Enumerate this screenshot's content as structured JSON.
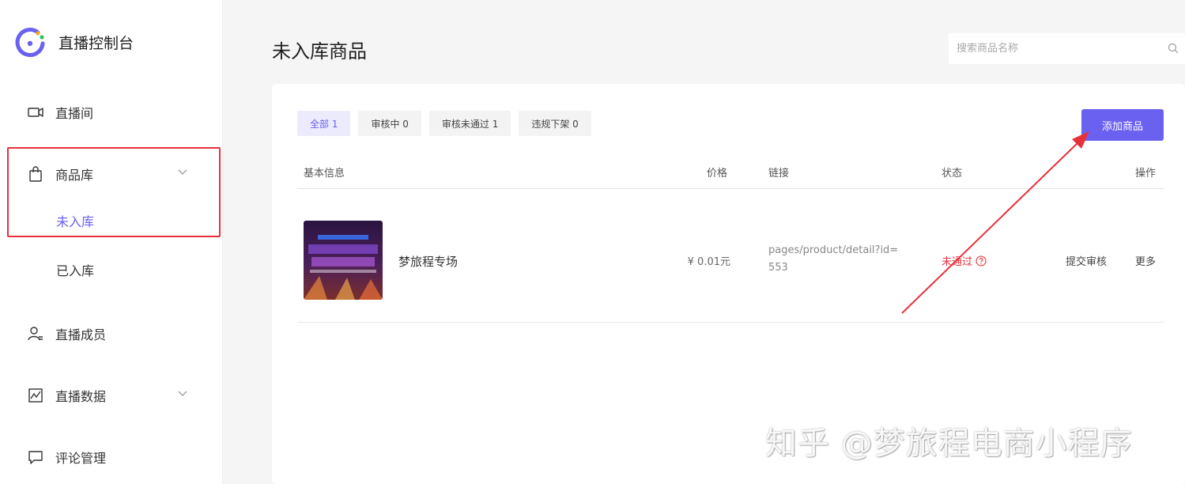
{
  "app": {
    "title": "直播控制台"
  },
  "sidebar": {
    "items": [
      {
        "label": "直播间"
      },
      {
        "label": "商品库"
      },
      {
        "label": "直播成员"
      },
      {
        "label": "直播数据"
      },
      {
        "label": "评论管理"
      }
    ],
    "goods_sub": [
      "未入库",
      "已入库"
    ]
  },
  "header": {
    "title": "未入库商品",
    "search_placeholder": "搜索商品名称"
  },
  "tabs": [
    {
      "label": "全部 1",
      "active": true
    },
    {
      "label": "审核中 0"
    },
    {
      "label": "审核未通过 1"
    },
    {
      "label": "违规下架 0"
    }
  ],
  "add_button": "添加商品",
  "table": {
    "columns": [
      "基本信息",
      "价格",
      "链接",
      "状态",
      "操作"
    ],
    "rows": [
      {
        "name": "梦旅程专场",
        "price": "¥ 0.01元",
        "link": "pages/product/detail?id=553",
        "status": "未通过",
        "actions": [
          "提交审核",
          "更多"
        ]
      }
    ]
  },
  "watermark": "知乎 @梦旅程电商小程序",
  "colors": {
    "accent": "#6a61f0",
    "danger": "#e8303a"
  }
}
